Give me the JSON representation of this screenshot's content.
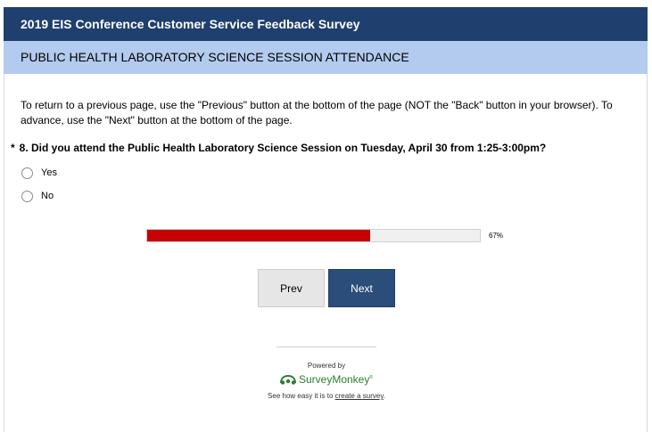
{
  "header": {
    "title": "2019 EIS Conference Customer Service Feedback Survey"
  },
  "page": {
    "title": "PUBLIC HEALTH LABORATORY SCIENCE SESSION ATTENDANCE"
  },
  "instructions": "To return to a previous page, use the \"Previous\" button at the bottom of the page (NOT the \"Back\" button in your browser). To advance, use the \"Next\" button at the bottom of the page.",
  "question": {
    "required_marker": "*",
    "text": "8. Did you attend the Public Health Laboratory Science Session on Tuesday, April 30 from 1:25-3:00pm?",
    "options": [
      {
        "label": "Yes",
        "selected": false
      },
      {
        "label": "No",
        "selected": false
      }
    ]
  },
  "progress": {
    "value": 0.67,
    "label": "67%",
    "fill_color": "#c70000"
  },
  "nav": {
    "prev_label": "Prev",
    "next_label": "Next"
  },
  "footer": {
    "powered_by": "Powered by",
    "brand": "SurveyMonkey",
    "tagline_prefix": "See how easy it is to ",
    "tagline_link": "create a survey",
    "tagline_suffix": "."
  },
  "colors": {
    "header_bg": "#1f3f6e",
    "page_title_bg": "#b2cbee",
    "next_button_bg": "#2a4d7a",
    "brand_green": "#2e7d32"
  }
}
